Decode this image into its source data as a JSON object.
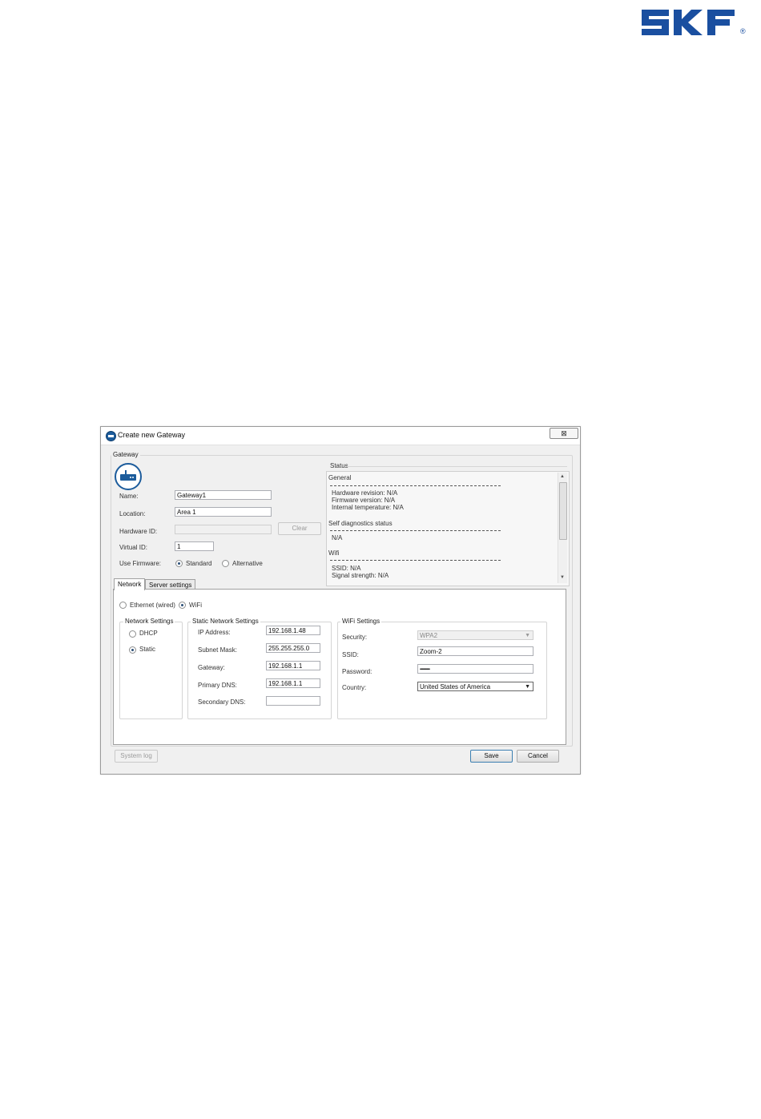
{
  "brand": {
    "logo_text": "SKF",
    "registered": "®",
    "color": "#1a4fa0"
  },
  "dialog": {
    "title": "Create new Gateway",
    "close_label": "⊠",
    "gateway_group": "Gateway",
    "fields": {
      "name_label": "Name:",
      "name_value": "Gateway1",
      "location_label": "Location:",
      "location_value": "Area 1",
      "hardware_id_label": "Hardware ID:",
      "hardware_id_value": "",
      "clear_label": "Clear",
      "virtual_id_label": "Virtual ID:",
      "virtual_id_value": "1",
      "firmware_label": "Use Firmware:",
      "firmware_standard": "Standard",
      "firmware_alternative": "Alternative"
    },
    "status": {
      "label": "Status",
      "general_heading": "General",
      "hardware_revision": "Hardware revision: N/A",
      "firmware_version": "Firmware version: N/A",
      "internal_temperature": "Internal temperature: N/A",
      "self_diag_heading": "Self diagnostics status",
      "self_diag_value": "N/A",
      "wifi_heading": "Wifi",
      "ssid": "SSID: N/A",
      "signal_strength": "Signal strength: N/A"
    },
    "tabs": [
      {
        "label": "Network"
      },
      {
        "label": "Server settings"
      }
    ],
    "network": {
      "ethernet_label": "Ethernet (wired)",
      "wifi_label": "WiFi",
      "network_settings_group": "Network Settings",
      "dhcp_label": "DHCP",
      "static_label": "Static",
      "static_group": "Static Network Settings",
      "ip_label": "IP Address:",
      "ip_value": "192.168.1.48",
      "subnet_label": "Subnet Mask:",
      "subnet_value": "255.255.255.0",
      "gateway_label": "Gateway:",
      "gateway_value": "192.168.1.1",
      "primary_dns_label": "Primary DNS:",
      "primary_dns_value": "192.168.1.1",
      "secondary_dns_label": "Secondary DNS:",
      "secondary_dns_value": "",
      "wifi_group": "WiFi Settings",
      "security_label": "Security:",
      "security_value": "WPA2",
      "ssid_label": "SSID:",
      "ssid_value": "Zoom-2",
      "password_label": "Password:",
      "password_value": "••••••••••••••••",
      "country_label": "Country:",
      "country_value": "United States of America"
    },
    "buttons": {
      "system_log": "System log",
      "save": "Save",
      "cancel": "Cancel"
    }
  }
}
